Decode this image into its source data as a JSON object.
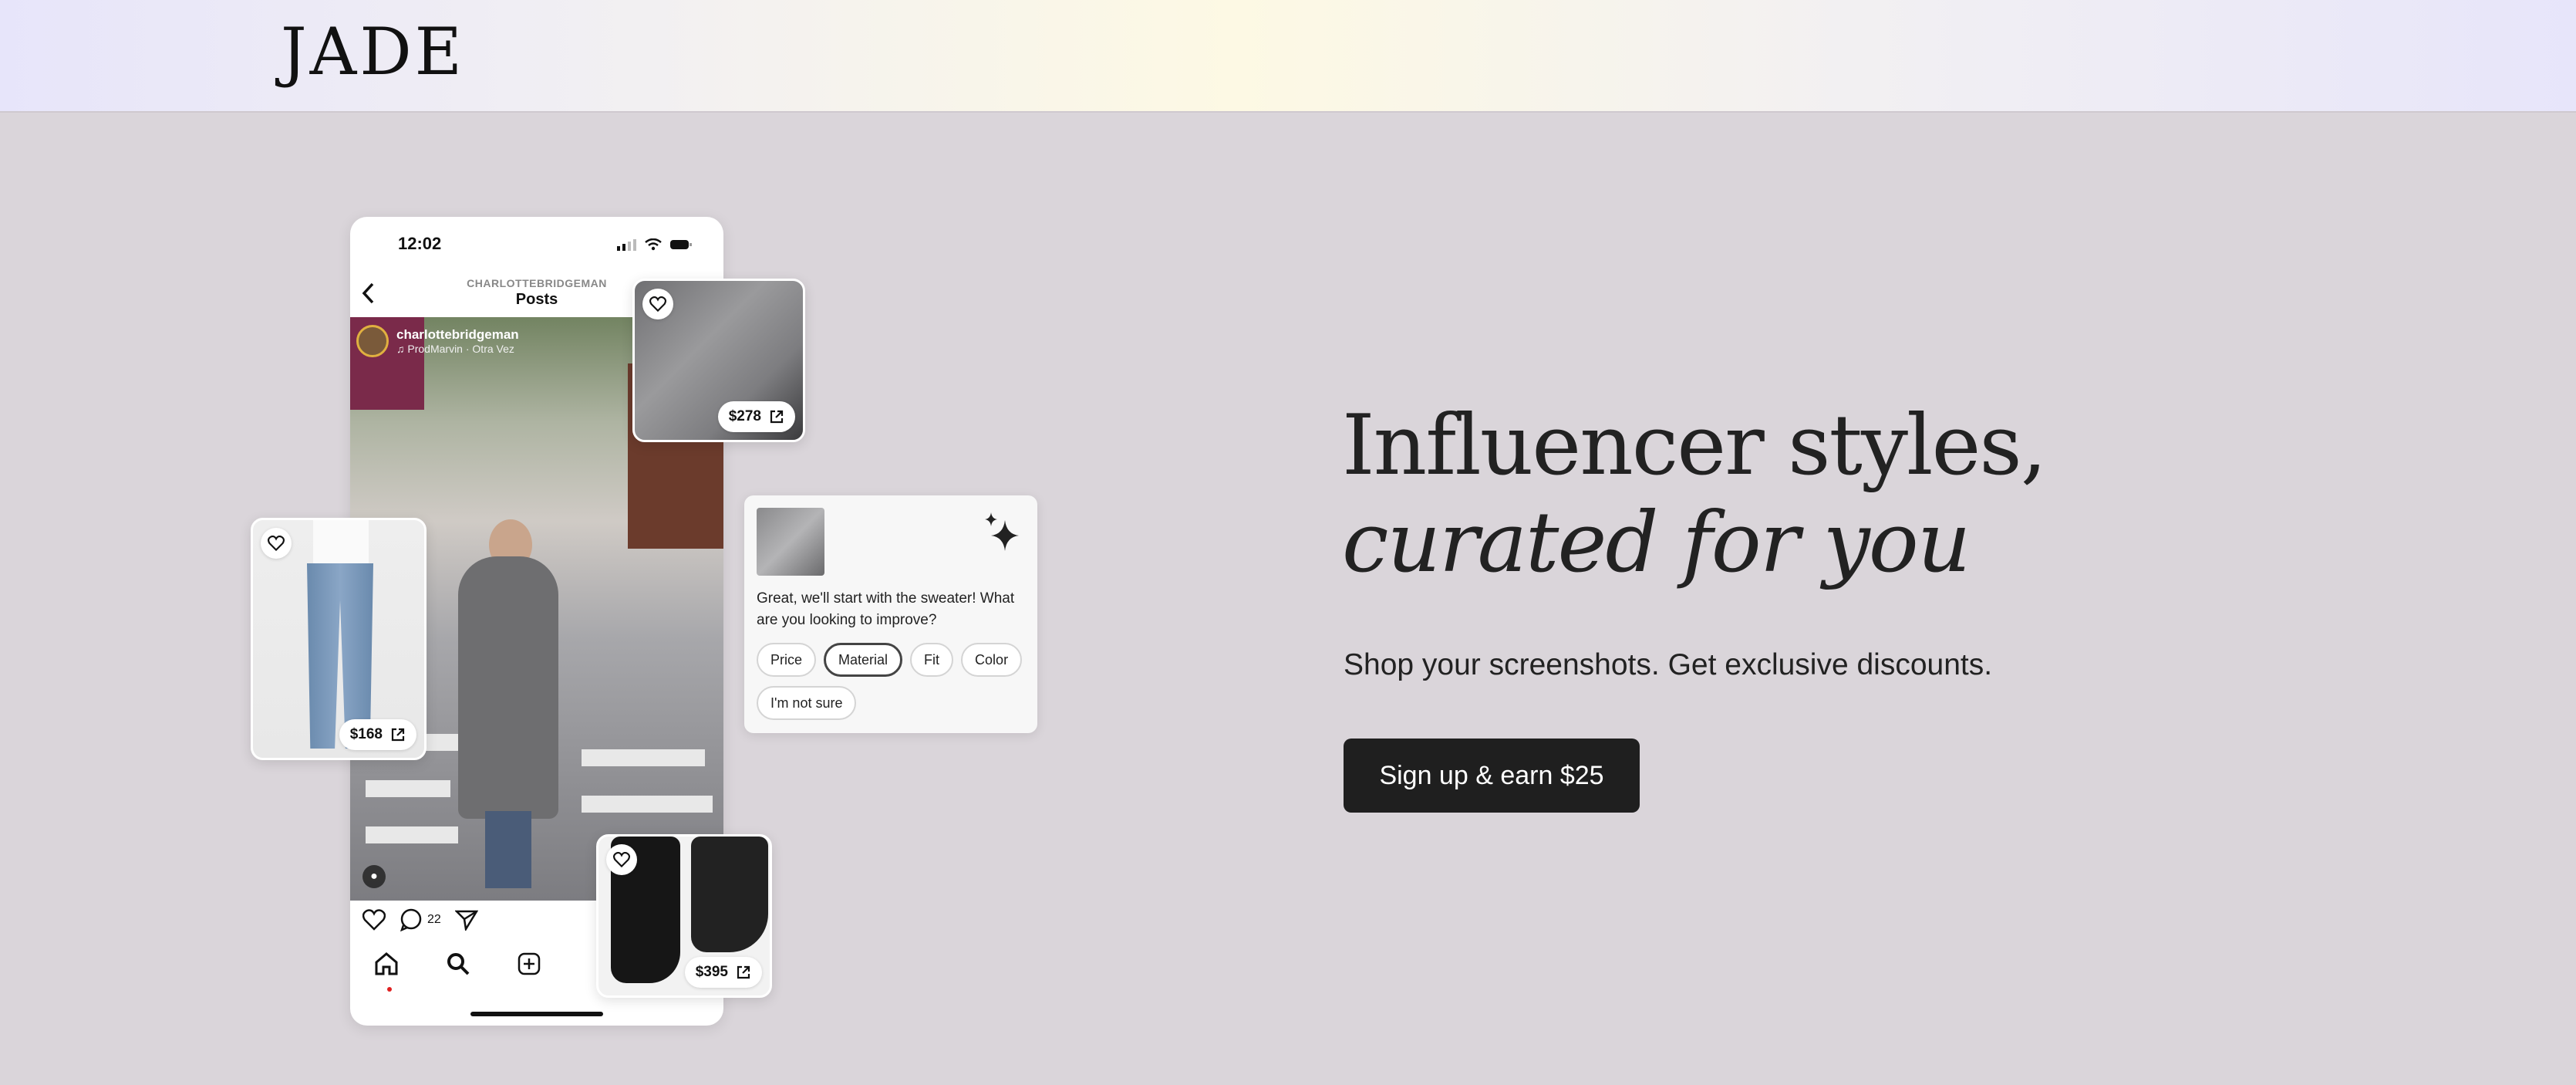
{
  "header": {
    "logo": "JADE"
  },
  "hero": {
    "headline_plain": "Influencer styles, ",
    "headline_italic": "curated for you",
    "subline": "Shop your screenshots. Get exclusive discounts.",
    "cta_label": "Sign up & earn $25"
  },
  "phone": {
    "time": "12:02",
    "post_account": "CHARLOTTEBRIDGEMAN",
    "post_title": "Posts",
    "author_name": "charlottebridgeman",
    "author_music": "♫ ProdMarvin · Otra Vez",
    "comment_count": "22"
  },
  "products": {
    "sweater_price": "$278",
    "jeans_price": "$168",
    "boots_price": "$395"
  },
  "assistant": {
    "message": "Great, we'll start with the sweater! What are you looking to improve?",
    "chips": [
      "Price",
      "Material",
      "Fit",
      "Color",
      "I'm not sure"
    ],
    "selected_chip": "Material"
  },
  "colors": {
    "background": "#dad5da",
    "cta": "#1f1f1f",
    "text": "#222222"
  }
}
